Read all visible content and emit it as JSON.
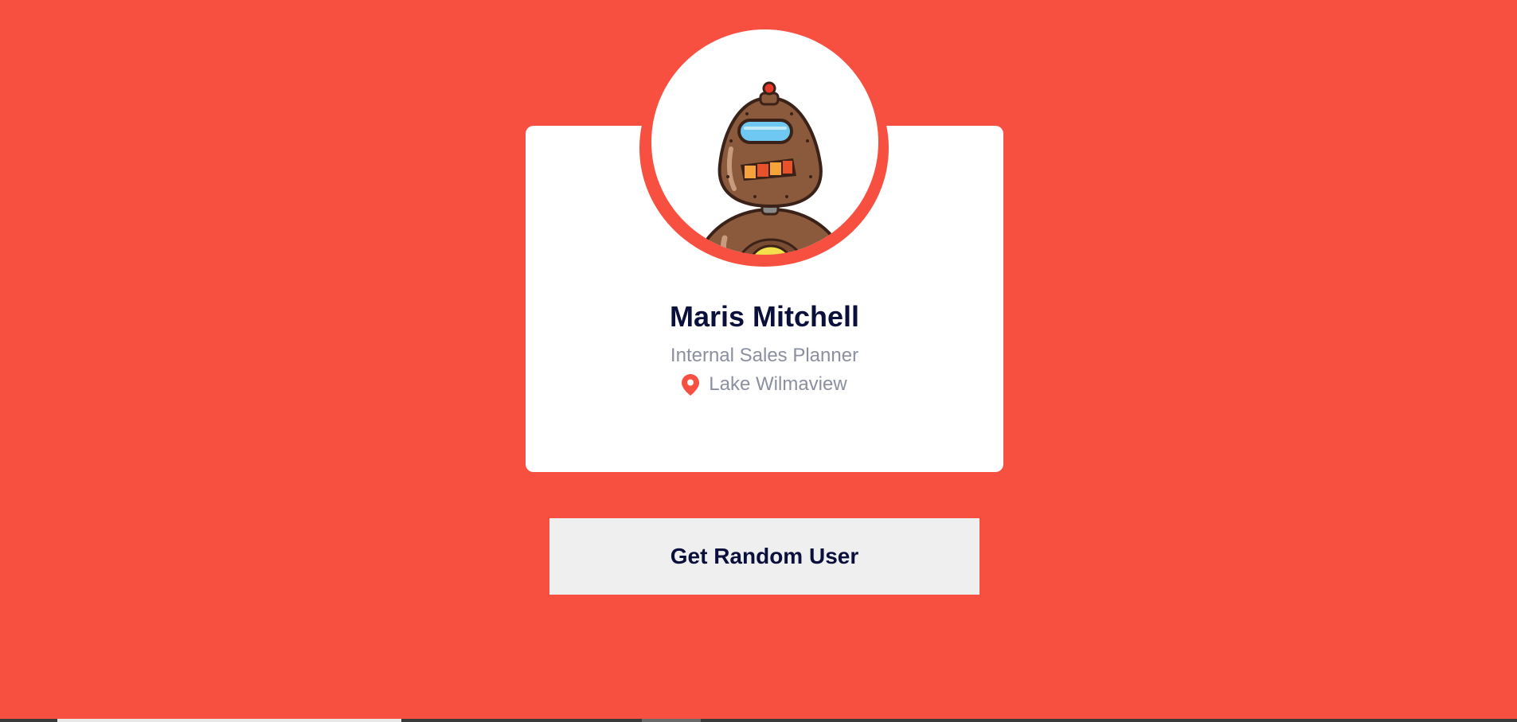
{
  "profile": {
    "name": "Maris Mitchell",
    "job_title": "Internal Sales Planner",
    "location": "Lake Wilmaview",
    "avatar_icon": "robot-avatar"
  },
  "actions": {
    "random_user_label": "Get Random User"
  },
  "colors": {
    "background": "#f74f40",
    "card": "#ffffff",
    "name_text": "#0b0f3b",
    "secondary_text": "#8b8f9f",
    "button_bg": "#efefef",
    "pin": "#f74f40"
  }
}
